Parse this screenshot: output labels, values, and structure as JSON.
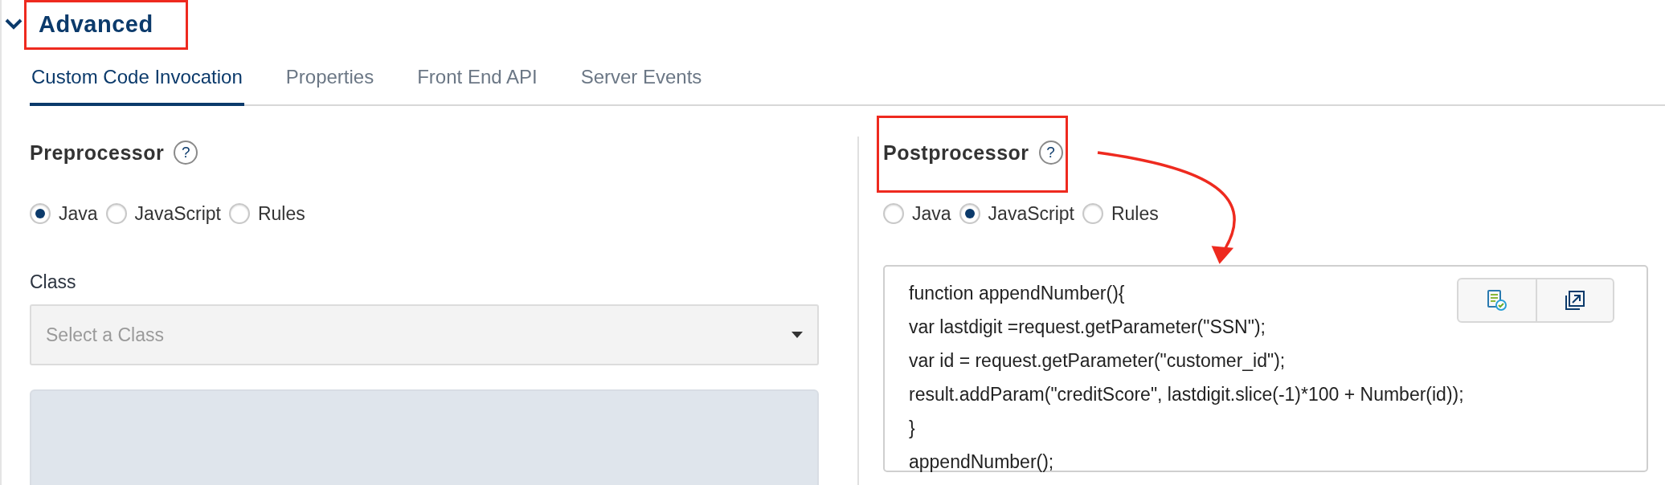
{
  "section": {
    "title": "Advanced",
    "expanded": true
  },
  "tabs": [
    {
      "label": "Custom Code Invocation",
      "selected": true
    },
    {
      "label": "Properties",
      "selected": false
    },
    {
      "label": "Front End API",
      "selected": false
    },
    {
      "label": "Server Events",
      "selected": false
    }
  ],
  "preprocessor": {
    "title": "Preprocessor",
    "help": "?",
    "options": [
      {
        "label": "Java",
        "selected": true
      },
      {
        "label": "JavaScript",
        "selected": false
      },
      {
        "label": "Rules",
        "selected": false
      }
    ],
    "class_field": {
      "label": "Class",
      "placeholder": "Select a Class"
    }
  },
  "postprocessor": {
    "title": "Postprocessor",
    "help": "?",
    "options": [
      {
        "label": "Java",
        "selected": false
      },
      {
        "label": "JavaScript",
        "selected": true
      },
      {
        "label": "Rules",
        "selected": false
      }
    ],
    "code_lines": [
      "function appendNumber(){",
      "var lastdigit =request.getParameter(\"SSN\");",
      "var id = request.getParameter(\"customer_id\");",
      "result.addParam(\"creditScore\", lastdigit.slice(-1)*100 + Number(id));",
      "}",
      "appendNumber();"
    ]
  }
}
